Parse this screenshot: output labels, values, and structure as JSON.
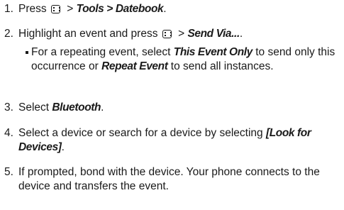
{
  "steps": [
    {
      "num": "1.",
      "before": "Press",
      "after": " > ",
      "path": "Tools > Datebook",
      "end": "."
    },
    {
      "num": "2.",
      "before": "Highlight an event and press",
      "after": " > ",
      "path": "Send Via...",
      "end": "."
    },
    {
      "num": "3.",
      "before": "Select ",
      "ui": "Bluetooth",
      "end": "."
    },
    {
      "num": "4.",
      "before": "Select a device or search for a device by selecting ",
      "ui": "[Look for Devices]",
      "end": "."
    },
    {
      "num": "5.",
      "text": "If prompted, bond with the device. Your phone connects to the device and transfers the event."
    }
  ],
  "sub_bullet": {
    "before": "For a repeating event, select ",
    "option1": "This Event Only",
    "middle": " to send only this occurrence or ",
    "option2": "Repeat Event",
    "after": " to send all instances."
  },
  "icons": {
    "menu_key": "menu-key-icon"
  }
}
